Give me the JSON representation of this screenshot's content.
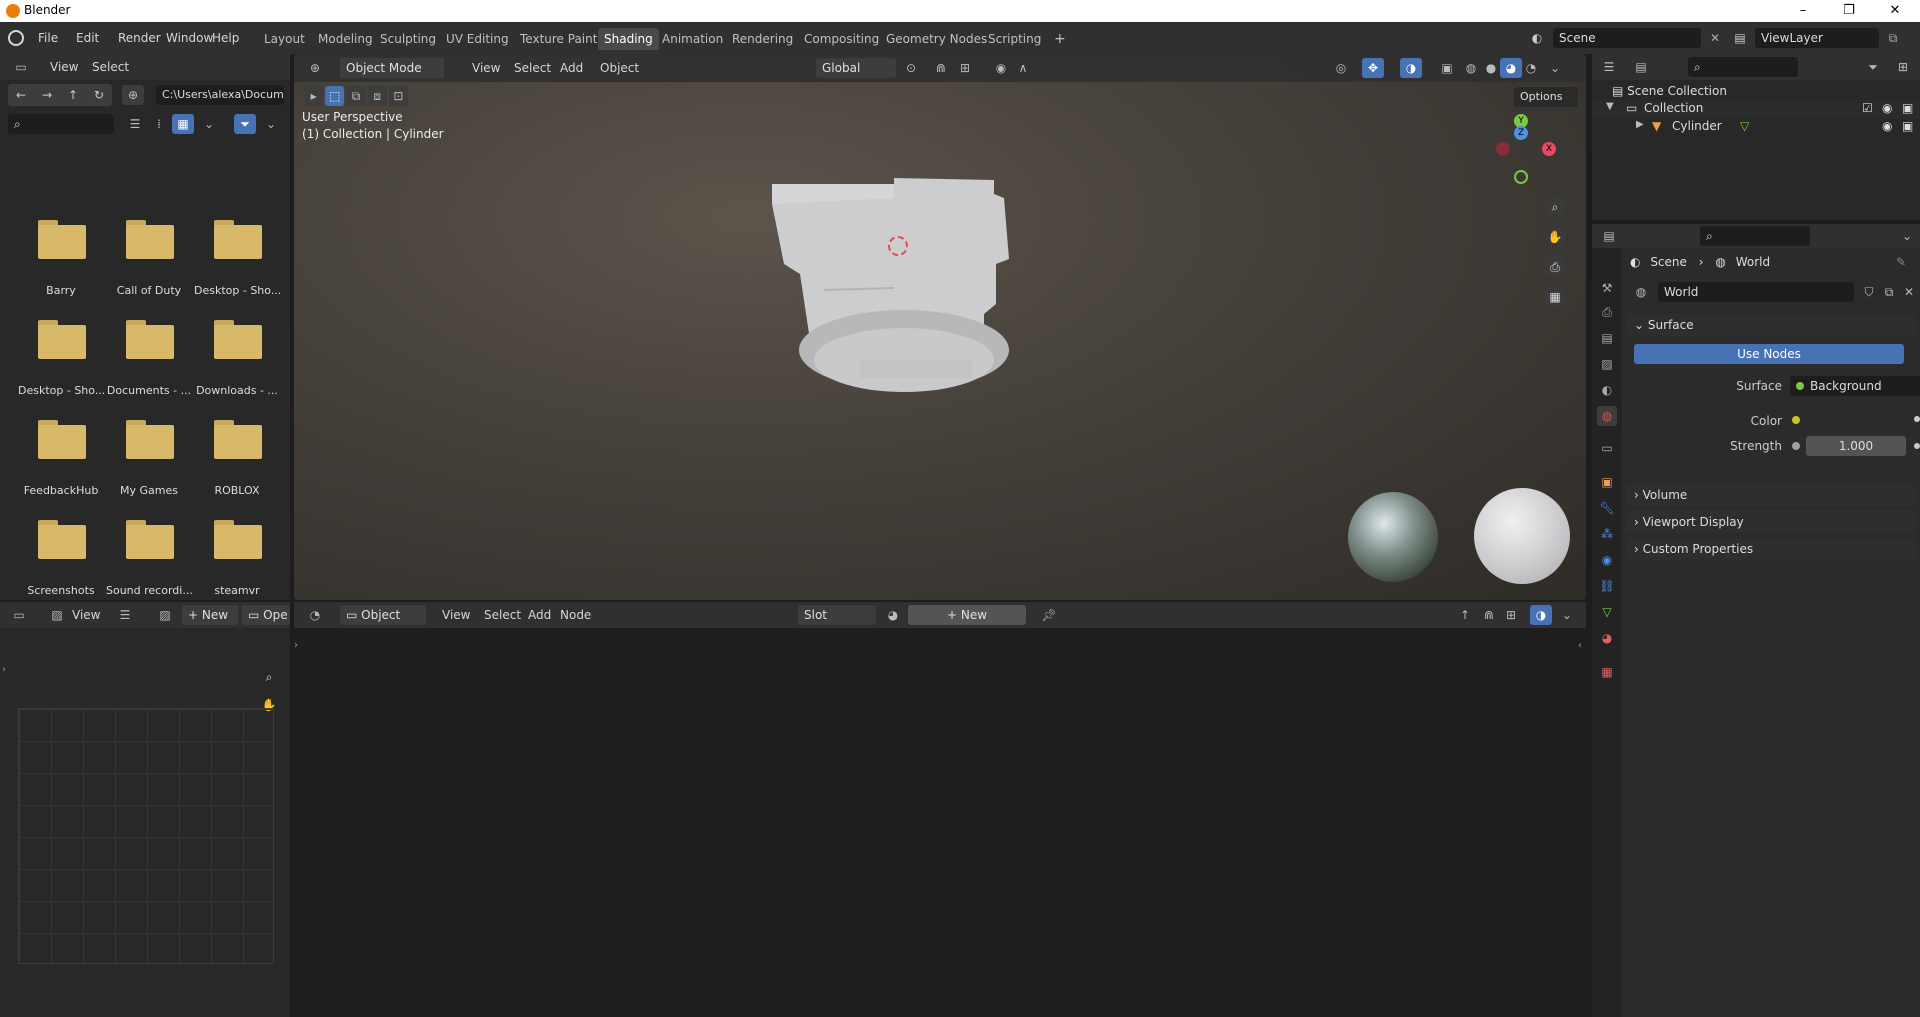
{
  "window": {
    "title": "Blender",
    "min": "–",
    "max": "❐",
    "close": "✕"
  },
  "menu": [
    "File",
    "Edit",
    "Render",
    "Window",
    "Help"
  ],
  "workspaces": [
    "Layout",
    "Modeling",
    "Sculpting",
    "UV Editing",
    "Texture Paint",
    "Shading",
    "Animation",
    "Rendering",
    "Compositing",
    "Geometry Nodes",
    "Scripting"
  ],
  "active_workspace": "Shading",
  "add_workspace": "+",
  "scene": {
    "name": "Scene",
    "view_layer": "ViewLayer"
  },
  "file_browser": {
    "menu": [
      "View",
      "Select"
    ],
    "path": "C:\\Users\\alexa\\Docum...",
    "items": [
      {
        "name": "Barry"
      },
      {
        "name": "Call of Duty"
      },
      {
        "name": "Desktop - Sho..."
      },
      {
        "name": "Desktop - Sho..."
      },
      {
        "name": "Documents - ..."
      },
      {
        "name": "Downloads - ..."
      },
      {
        "name": "FeedbackHub"
      },
      {
        "name": "My Games"
      },
      {
        "name": "ROBLOX"
      },
      {
        "name": "Screenshots"
      },
      {
        "name": "Sound recordi..."
      },
      {
        "name": "steamvr"
      }
    ]
  },
  "viewport": {
    "mode": "Object Mode",
    "menu": [
      "View",
      "Select",
      "Add",
      "Object"
    ],
    "orientation": "Global",
    "options": "Options",
    "overlay_line1": "User Perspective",
    "overlay_line2": "(1) Collection | Cylinder",
    "gizmo": {
      "x": "X",
      "y": "Y",
      "z": "Z"
    },
    "colors": {
      "x": "#e84a5f",
      "y": "#7ac943",
      "z": "#4e8fe8"
    }
  },
  "image_editor": {
    "view": "View",
    "new": "New",
    "open": "Ope"
  },
  "node_editor": {
    "type": "Object",
    "menu": [
      "View",
      "Select",
      "Add",
      "Node"
    ],
    "slot": "Slot",
    "new": "New"
  },
  "outliner": {
    "scene_collection": "Scene Collection",
    "collection": "Collection",
    "object": "Cylinder"
  },
  "properties": {
    "breadcrumb_scene": "Scene",
    "breadcrumb_world": "World",
    "world_name": "World",
    "surface_section": "Surface",
    "use_nodes": "Use Nodes",
    "surface_label": "Surface",
    "surface_value": "Background",
    "color_label": "Color",
    "strength_label": "Strength",
    "strength_value": "1.000",
    "sections": [
      "Volume",
      "Viewport Display",
      "Custom Properties"
    ]
  },
  "accent": "#4772b3"
}
